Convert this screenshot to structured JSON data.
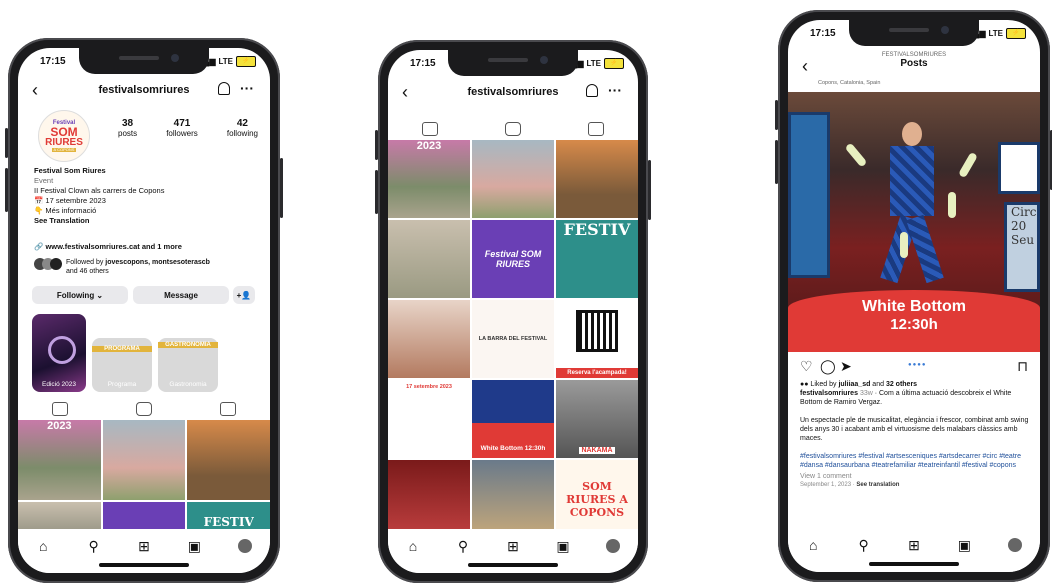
{
  "status": {
    "time": "17:15",
    "network": "LTE"
  },
  "profile": {
    "username": "festivalsomriures",
    "logo_text": [
      "Festival",
      "SOM",
      "RIURES",
      "A COPONS"
    ],
    "stats": [
      {
        "value": "38",
        "label": "posts"
      },
      {
        "value": "471",
        "label": "followers"
      },
      {
        "value": "42",
        "label": "following"
      }
    ],
    "name": "Festival Som Riures",
    "category": "Event",
    "bio1": "II Festival Clown als carrers de Copons",
    "bio2": "📅 17 setembre 2023",
    "bio3": "👇 Més informació",
    "see_translation": "See Translation",
    "link": "www.festivalsomriures.cat and 1 more",
    "followed_by_prefix": "Followed by ",
    "followed_by_names": "jovescopons, montsesoterascb",
    "followed_by_suffix": "and 46 others",
    "following_btn": "Following ⌄",
    "message_btn": "Message",
    "highlights": [
      "Edició 2023",
      "Programa",
      "Gastronomia"
    ],
    "highlight_banners": [
      "PROGRAMA",
      "GASTRONOMIA"
    ],
    "grid_text": [
      "2023",
      "",
      "",
      "",
      "",
      "FESTIV"
    ]
  },
  "grid_screen": {
    "username": "festivalsomriures",
    "tiles": [
      "2023",
      "",
      "",
      "",
      "Festival SOM RIURES",
      "FESTIV",
      "",
      "LA BARRA DEL FESTIVAL",
      "Reserva l'acampada!",
      "17 setembre 2023",
      "White Bottom 12:30h",
      "NAKAMA",
      "",
      "",
      "SOM RIURES A COPONS"
    ]
  },
  "post_screen": {
    "header_user": "FESTIVALSOMRIURES",
    "header_title": "Posts",
    "location": "Copons, Catalonia, Spain",
    "banner_title": "White Bottom",
    "banner_time": "12:30h",
    "side_text_right": [
      "Circ",
      "20",
      "Seu"
    ],
    "liked_prefix": "Liked by ",
    "liked_user": "juliiaa_sd",
    "liked_mid": " and ",
    "liked_count": "32 others",
    "caption_user": "festivalsomriures",
    "caption_time": "33w",
    "caption_text": " · Com a última actuació descobreix el White Bottom de Ramiro Vergaz.",
    "body": "Un espectacle ple de musicalitat, elegància i frescor, combinat amb swing dels anys 30 i acabant amb el virtuosisme dels malabars clàssics amb maces.",
    "hashtags": "#festivalsomriures #festival #artsesceniques #artsdecarrer #circ #teatre #dansa #dansaurbana #teatrefamiliar #teatreinfantil #festival #copons",
    "comments": "View 1 comment",
    "date": "September 1, 2023",
    "see_translation": "See translation"
  },
  "colors": {
    "red": "#e03a36",
    "purple": "#6a3fb5",
    "teal": "#2d8f8a",
    "gold": "#e2b43c"
  }
}
